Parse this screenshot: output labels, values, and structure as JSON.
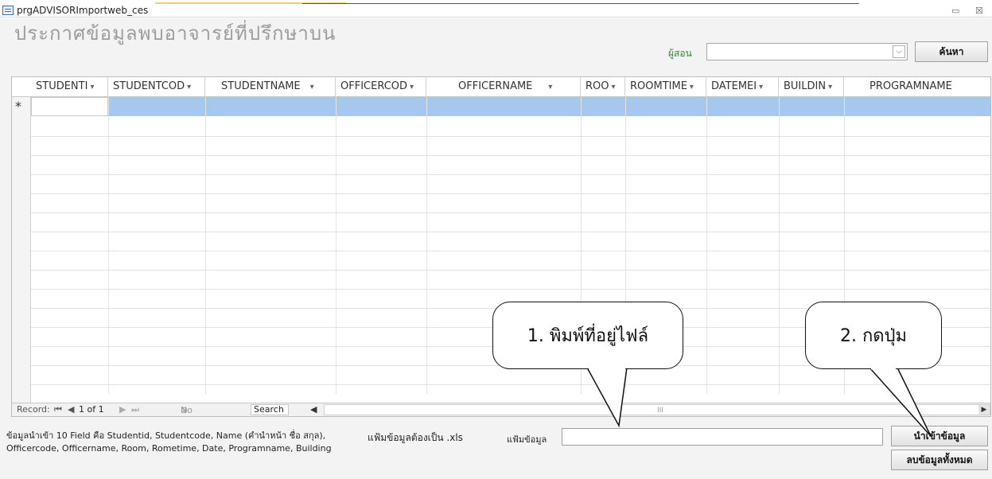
{
  "window": {
    "title": "prgADVISORImportweb_ces",
    "minimize_glyph": "▭",
    "close_glyph": "☒"
  },
  "form": {
    "heading": "ประกาศข้อมูลพบอาจารย์ที่ปรึกษาบน",
    "filter_label": "ผู้สอน",
    "filter_value": "",
    "dropdown_glyph": "⌵",
    "search_button": "ค้นหา"
  },
  "datasheet": {
    "columns": [
      {
        "label": "STUDENTI"
      },
      {
        "label": "STUDENTCOD"
      },
      {
        "label": "STUDENTNAME"
      },
      {
        "label": "OFFICERCOD"
      },
      {
        "label": "OFFICERNAME"
      },
      {
        "label": "ROO"
      },
      {
        "label": "ROOMTIME"
      },
      {
        "label": "DATEMEI"
      },
      {
        "label": "BUILDIN"
      },
      {
        "label": "PROGRAMNAME"
      }
    ],
    "new_record_marker": "*",
    "navigation": {
      "record_label": "Record:",
      "first_glyph": "⏮",
      "prev_glyph": "◀",
      "position": "1 of 1",
      "next_glyph": "▶",
      "last_glyph": "⏭",
      "filter_text": "No Filter",
      "search_text": "Search",
      "scroll_left_glyph": "◀",
      "scroll_right_glyph": "▶",
      "scroll_thumb_glyph": "III"
    }
  },
  "footer": {
    "info_text": "ข้อมูลนำเข้า 10 Field คือ  Studentid, Studentcode, Name (คำนำหน้า ชื่อ สกุล), Officercode, Officername, Room, Rometime, Date, Programname, Building",
    "file_note": "แฟ้มข้อมูลต้องเป็น .xls",
    "file_label": "แฟ้มข้อมูล",
    "file_value": "",
    "import_button": "นำเข้าข้อมูล",
    "delete_button": "ลบข้อมูลทั้งหมด"
  },
  "callouts": {
    "step1": "1. พิมพ์ที่อยู่ไฟล์",
    "step2": "2. กดปุ่ม"
  }
}
